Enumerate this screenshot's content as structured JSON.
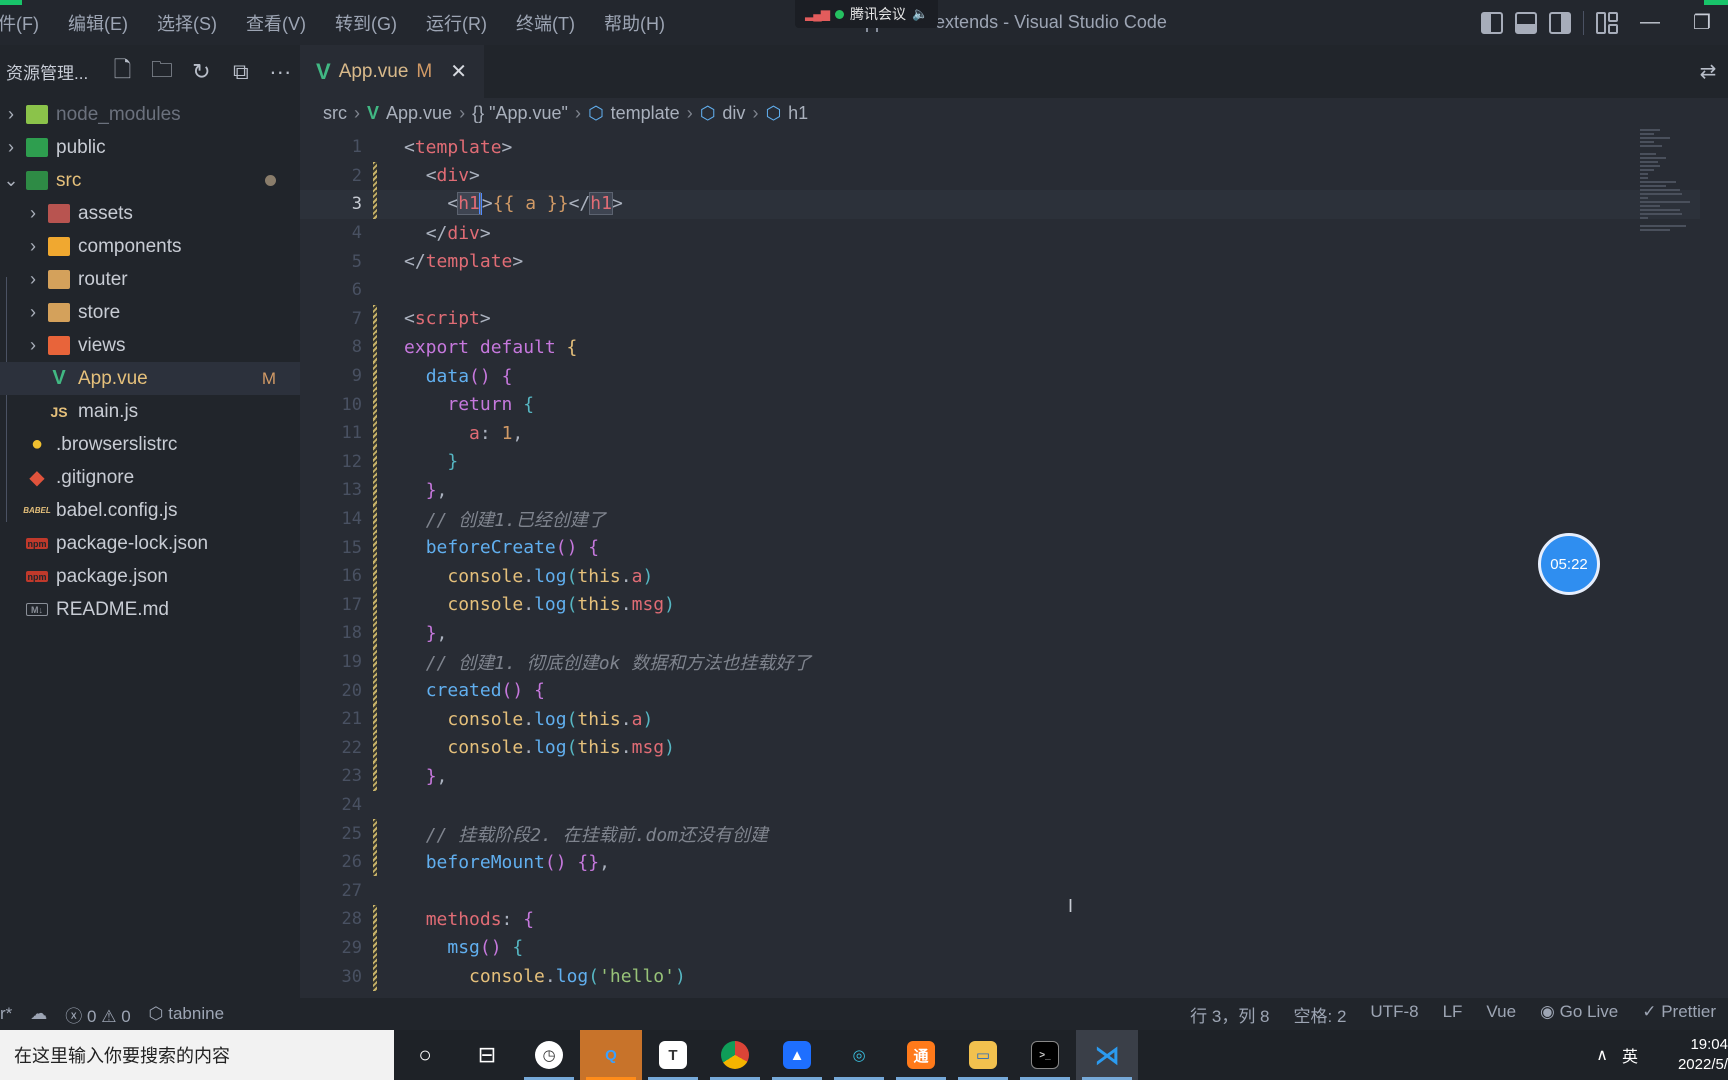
{
  "titlebar": {
    "menu": [
      "件(F)",
      "编辑(E)",
      "选择(S)",
      "查看(V)",
      "转到(G)",
      "运行(R)",
      "终端(T)",
      "帮助(H)"
    ],
    "window_title": "App.vue - extends - Visual Studio Code",
    "meeting_label": "腾讯会议",
    "minimize": "—",
    "restore": "❐"
  },
  "sidebar": {
    "title": "资源管理...",
    "actions": [
      "new-file",
      "new-folder",
      "refresh",
      "collapse-all",
      "more"
    ],
    "items": [
      {
        "name": "node_modules",
        "type": "folder",
        "expanded": false,
        "depth": 0,
        "icon_color": "#8bc34a",
        "dim": true
      },
      {
        "name": "public",
        "type": "folder",
        "expanded": false,
        "depth": 0,
        "icon_color": "#2e9e4f"
      },
      {
        "name": "src",
        "type": "folder",
        "expanded": true,
        "depth": 0,
        "icon_color": "#2e8b45",
        "modified_dot": true
      },
      {
        "name": "assets",
        "type": "folder",
        "expanded": false,
        "depth": 1,
        "icon_color": "#b85450"
      },
      {
        "name": "components",
        "type": "folder",
        "expanded": false,
        "depth": 1,
        "icon_color": "#f0a830"
      },
      {
        "name": "router",
        "type": "folder",
        "expanded": false,
        "depth": 1,
        "icon_color": "#d4a15b"
      },
      {
        "name": "store",
        "type": "folder",
        "expanded": false,
        "depth": 1,
        "icon_color": "#d4a15b"
      },
      {
        "name": "views",
        "type": "folder",
        "expanded": false,
        "depth": 1,
        "icon_color": "#e8643a"
      },
      {
        "name": "App.vue",
        "type": "file",
        "depth": 1,
        "icon": "V",
        "icon_color": "#41b883",
        "badge": "M",
        "active": true
      },
      {
        "name": "main.js",
        "type": "file",
        "depth": 1,
        "icon": "JS",
        "icon_color": "#e5c07b"
      },
      {
        "name": ".browserslistrc",
        "type": "file",
        "depth": 0,
        "icon": "●",
        "icon_color": "#f0c030"
      },
      {
        "name": ".gitignore",
        "type": "file",
        "depth": 0,
        "icon": "◆",
        "icon_color": "#e0533c"
      },
      {
        "name": "babel.config.js",
        "type": "file",
        "depth": 0,
        "icon": "BABEL",
        "icon_color": "#e5c07b"
      },
      {
        "name": "package-lock.json",
        "type": "file",
        "depth": 0,
        "icon": "npm",
        "icon_color": "#c0392b"
      },
      {
        "name": "package.json",
        "type": "file",
        "depth": 0,
        "icon": "npm",
        "icon_color": "#c0392b"
      },
      {
        "name": "README.md",
        "type": "file",
        "depth": 0,
        "icon": "M↓",
        "icon_color": "#8a8f98"
      }
    ]
  },
  "editor": {
    "tab": {
      "label": "App.vue",
      "badge": "M"
    },
    "breadcrumb": [
      "src",
      "App.vue",
      "{} \"App.vue\"",
      "template",
      "div",
      "h1"
    ],
    "current_line": 3,
    "lines": [
      {
        "n": "1",
        "mod": false
      },
      {
        "n": "2",
        "mod": true
      },
      {
        "n": "3",
        "mod": true
      },
      {
        "n": "4",
        "mod": false
      },
      {
        "n": "5",
        "mod": false
      },
      {
        "n": "6",
        "mod": false
      },
      {
        "n": "7",
        "mod": true
      },
      {
        "n": "8",
        "mod": true
      },
      {
        "n": "9",
        "mod": true
      },
      {
        "n": "10",
        "mod": true
      },
      {
        "n": "11",
        "mod": true
      },
      {
        "n": "12",
        "mod": true
      },
      {
        "n": "13",
        "mod": true
      },
      {
        "n": "14",
        "mod": true
      },
      {
        "n": "15",
        "mod": true
      },
      {
        "n": "16",
        "mod": true
      },
      {
        "n": "17",
        "mod": true
      },
      {
        "n": "18",
        "mod": true
      },
      {
        "n": "19",
        "mod": true
      },
      {
        "n": "20",
        "mod": true
      },
      {
        "n": "21",
        "mod": true
      },
      {
        "n": "22",
        "mod": true
      },
      {
        "n": "23",
        "mod": true
      },
      {
        "n": "24",
        "mod": false
      },
      {
        "n": "25",
        "mod": true
      },
      {
        "n": "26",
        "mod": true
      },
      {
        "n": "27",
        "mod": false
      },
      {
        "n": "28",
        "mod": true
      },
      {
        "n": "29",
        "mod": true
      },
      {
        "n": "30",
        "mod": true
      }
    ],
    "code": {
      "l1": [
        "<",
        "template",
        ">"
      ],
      "l2": [
        "<",
        "div",
        ">"
      ],
      "l3": [
        "<",
        "h1",
        ">",
        "{{ a }}",
        "</",
        "h1",
        ">"
      ],
      "l4": [
        "</",
        "div",
        ">"
      ],
      "l5": [
        "</",
        "template",
        ">"
      ],
      "l7": [
        "<",
        "script",
        ">"
      ],
      "l8": [
        "export default",
        " {"
      ],
      "l9": [
        "data",
        "()",
        " {"
      ],
      "l10": [
        "return",
        " {"
      ],
      "l11": [
        "a",
        ": ",
        "1",
        ","
      ],
      "l12": [
        "}"
      ],
      "l13": [
        "}",
        ","
      ],
      "l14": "// 创建1.已经创建了",
      "l15": [
        "beforeCreate",
        "()",
        " {"
      ],
      "l16": [
        "console",
        ".",
        "log",
        "(",
        "this",
        ".",
        "a",
        ")"
      ],
      "l17": [
        "console",
        ".",
        "log",
        "(",
        "this",
        ".",
        "msg",
        ")"
      ],
      "l18": [
        "}",
        ","
      ],
      "l19": "// 创建1. 彻底创建ok 数据和方法也挂载好了",
      "l20": [
        "created",
        "()",
        " {"
      ],
      "l21": [
        "console",
        ".",
        "log",
        "(",
        "this",
        ".",
        "a",
        ")"
      ],
      "l22": [
        "console",
        ".",
        "log",
        "(",
        "this",
        ".",
        "msg",
        ")"
      ],
      "l23": [
        "}",
        ","
      ],
      "l25": "// 挂载阶段2. 在挂载前.dom还没有创建",
      "l26": [
        "beforeMount",
        "()",
        " {}",
        ","
      ],
      "l28": [
        "methods",
        ":",
        " {"
      ],
      "l29": [
        "msg",
        "()",
        " {"
      ],
      "l30": [
        "console",
        ".",
        "log",
        "(",
        "'hello'",
        ")"
      ]
    }
  },
  "timer": "05:22",
  "statusbar": {
    "branch_fragment": "r*",
    "errors": "0",
    "warnings": "0",
    "tabnine": "tabnine",
    "position": "行 3，列 8",
    "indent": "空格: 2",
    "encoding": "UTF-8",
    "eol": "LF",
    "language": "Vue",
    "go_live": "Go Live",
    "prettier": "Prettier"
  },
  "taskbar": {
    "search_placeholder": "在这里输入你要搜索的内容",
    "ime": "英",
    "time": "19:04",
    "date": "2022/5/"
  }
}
